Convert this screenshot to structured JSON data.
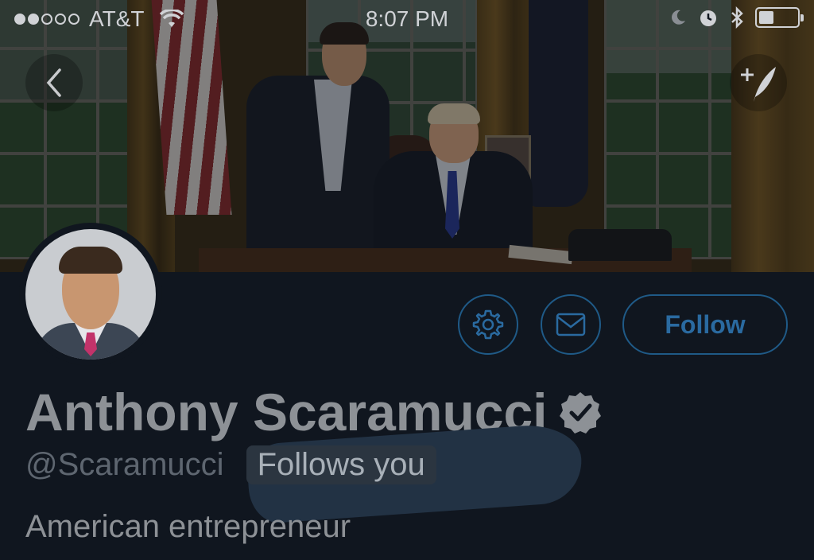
{
  "status_bar": {
    "carrier": "AT&T",
    "signal_dots_filled": 2,
    "signal_dots_total": 5,
    "time": "8:07 PM",
    "battery_level": 0.35,
    "icons": [
      "wifi-icon",
      "moon-icon",
      "alarm-icon",
      "bluetooth-icon",
      "battery-icon"
    ]
  },
  "nav": {
    "back_icon": "chevron-left-icon",
    "compose_icon": "compose-tweet-icon"
  },
  "profile": {
    "name": "Anthony Scaramucci",
    "verified": true,
    "handle": "@Scaramucci",
    "follows_you": "Follows you",
    "bio": "American entrepreneur"
  },
  "actions": {
    "settings_icon": "gear-icon",
    "message_icon": "envelope-icon",
    "follow_label": "Follow"
  },
  "colors": {
    "background": "#10161f",
    "accent": "#1f5a87",
    "scribble": "#223244"
  }
}
